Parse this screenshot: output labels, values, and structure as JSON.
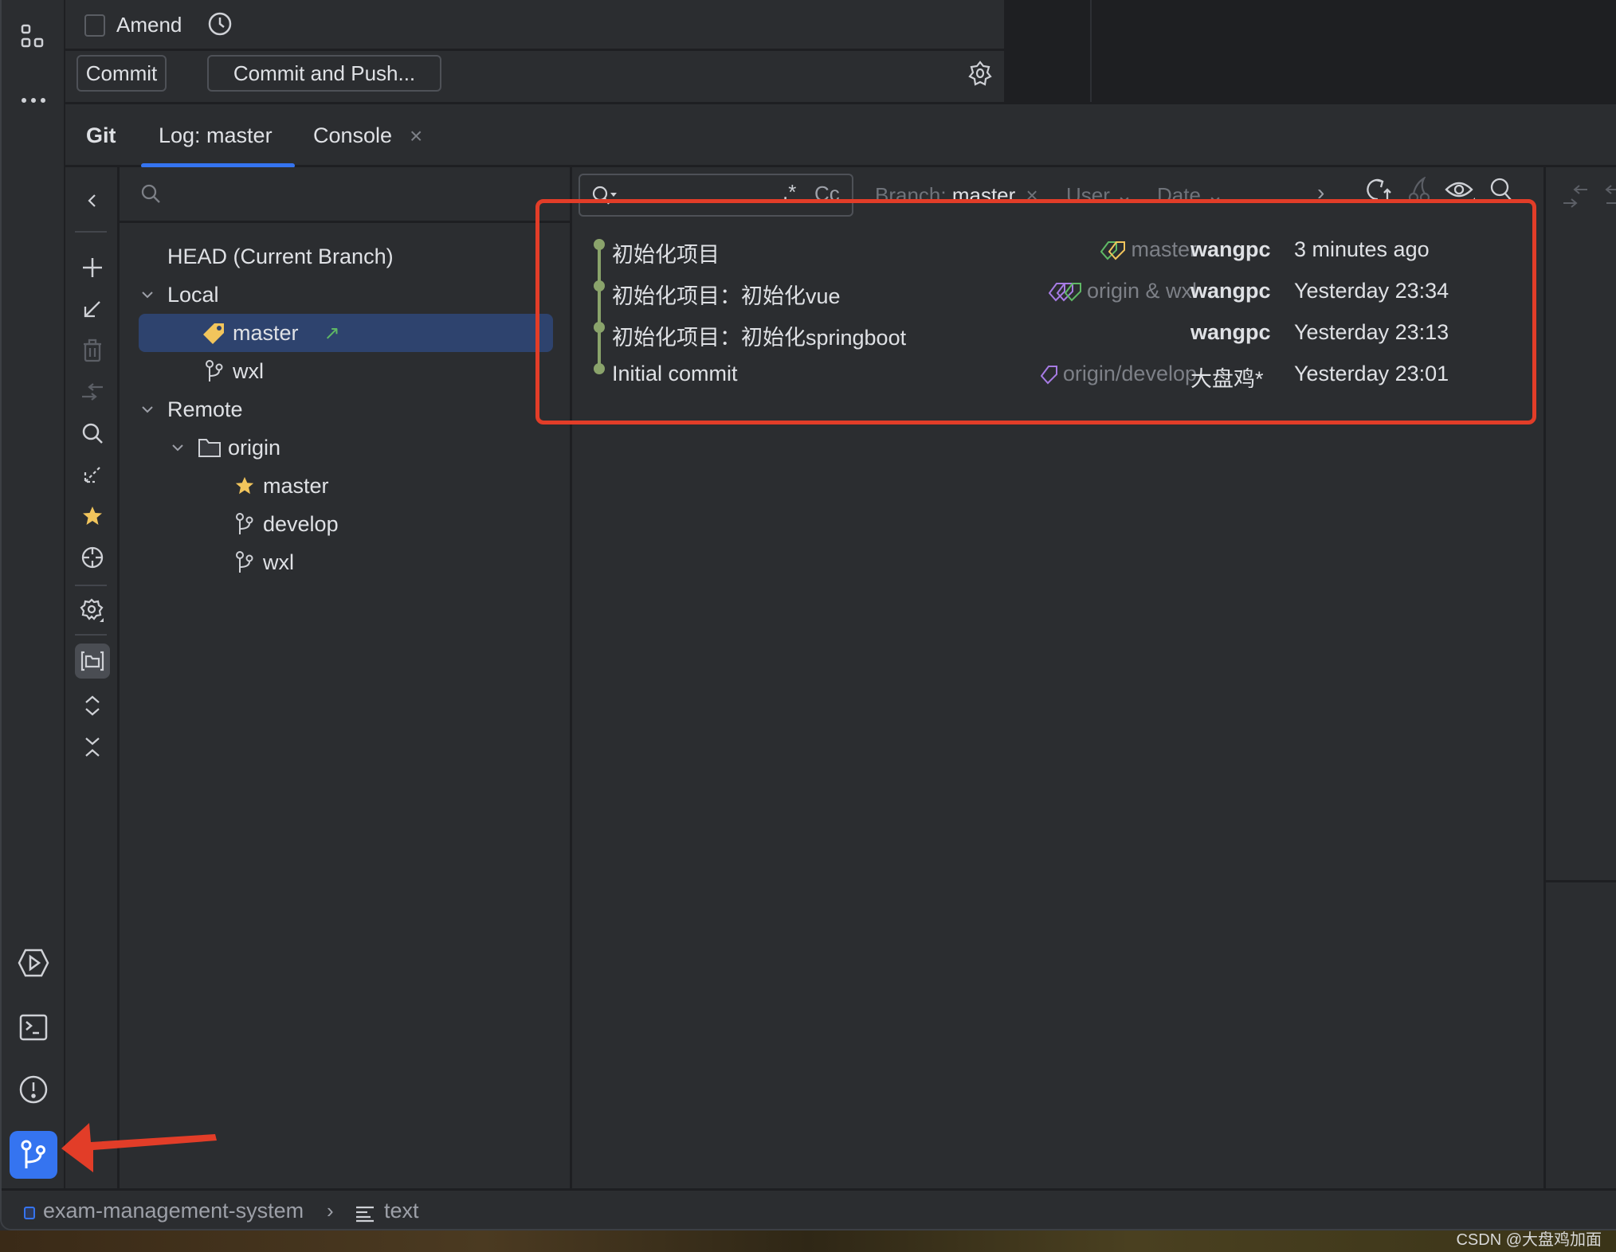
{
  "commit_panel": {
    "amend_label": "Amend",
    "amend_checked": false,
    "commit_button": "Commit",
    "commit_and_push_button": "Commit and Push..."
  },
  "tabs": [
    {
      "label": "Git",
      "active": false
    },
    {
      "label": "Log: master",
      "active": true
    },
    {
      "label": "Console",
      "closable": true,
      "close_glyph": "×"
    }
  ],
  "branch_tree": {
    "search_placeholder": "",
    "head": "HEAD (Current Branch)",
    "local_label": "Local",
    "local": [
      {
        "name": "master",
        "icon": "tag-icon",
        "selected": true,
        "outgoing_glyph": "↗"
      },
      {
        "name": "wxl",
        "icon": "branch-icon"
      }
    ],
    "remote_label": "Remote",
    "remotes": [
      {
        "name": "origin",
        "branches": [
          {
            "name": "master",
            "icon": "star-icon"
          },
          {
            "name": "develop",
            "icon": "branch-icon"
          },
          {
            "name": "wxl",
            "icon": "branch-icon"
          }
        ]
      }
    ]
  },
  "log": {
    "filter_placeholder": "",
    "regex_glyph": ".*",
    "case_glyph": "Cc",
    "branch_filter_label": "Branch:",
    "branch_filter_value": "master",
    "branch_filter_clear": "×",
    "user_filter": "User ⌄",
    "date_filter": "Date ⌄",
    "more_glyph": "›",
    "commits": [
      {
        "message": "初始化项目",
        "refs": "master",
        "ref_tags": [
          "green",
          "yellow"
        ],
        "author": "wangpc",
        "author_bold": true,
        "date": "3 minutes ago"
      },
      {
        "message": "初始化项目：初始化vue",
        "refs": "origin & wxl",
        "ref_tags": [
          "purple",
          "purple",
          "green"
        ],
        "author": "wangpc",
        "author_bold": true,
        "date": "Yesterday 23:34"
      },
      {
        "message": "初始化项目：初始化springboot",
        "refs": "",
        "ref_tags": [],
        "author": "wangpc",
        "author_bold": true,
        "date": "Yesterday 23:13"
      },
      {
        "message": "Initial commit",
        "refs": "origin/develop",
        "ref_tags": [
          "purple"
        ],
        "author": "大盘鸡*",
        "author_bold": false,
        "date": "Yesterday 23:01"
      }
    ]
  },
  "status_bar": {
    "project": "exam-management-system",
    "separator": "›",
    "file": "text"
  },
  "watermark": "CSDN @大盘鸡加面",
  "colors": {
    "accent": "#3574f0",
    "graph": "#8aa36b",
    "highlight": "#e23d28",
    "tag_yellow": "#f2c55c",
    "tag_green": "#5fb865",
    "tag_purple": "#a67be3",
    "selection": "#2e436e"
  }
}
